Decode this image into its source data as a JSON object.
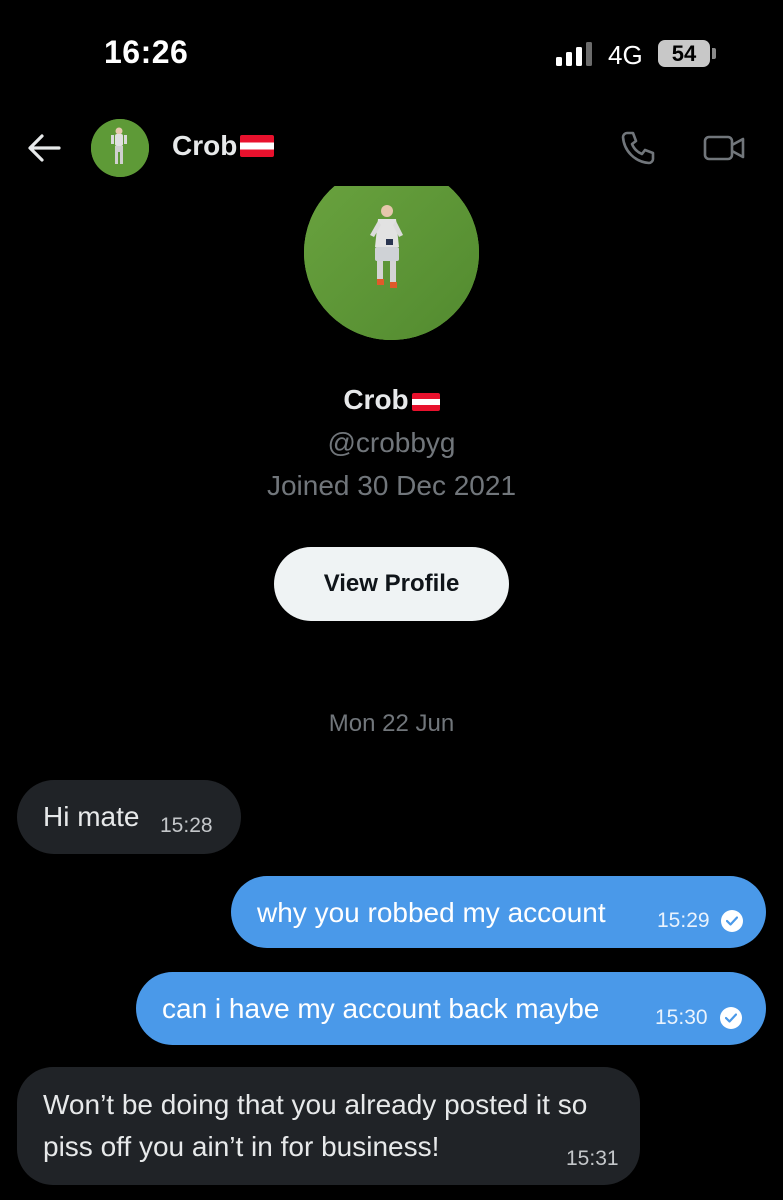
{
  "status_bar": {
    "time": "16:26",
    "network": "4G",
    "battery": "54"
  },
  "header": {
    "contact_name": "Crob",
    "flag": "Austria"
  },
  "profile": {
    "name": "Crob",
    "handle": "@crobbyg",
    "joined": "Joined 30 Dec 2021",
    "view_profile_label": "View Profile"
  },
  "date_separator": "Mon 22 Jun",
  "messages": [
    {
      "direction": "received",
      "text": "Hi mate",
      "time": "15:28"
    },
    {
      "direction": "sent",
      "text": "why you robbed my account",
      "time": "15:29",
      "read": true
    },
    {
      "direction": "sent",
      "text": "can i have my account back maybe",
      "time": "15:30",
      "read": true
    },
    {
      "direction": "received",
      "text": "Won’t be doing that you already posted it so piss off you ain’t in for business!",
      "time": "15:31"
    }
  ],
  "colors": {
    "background": "#000000",
    "sent_bubble": "#4a99e9",
    "received_bubble": "#202327",
    "secondary_text": "#71767b"
  }
}
